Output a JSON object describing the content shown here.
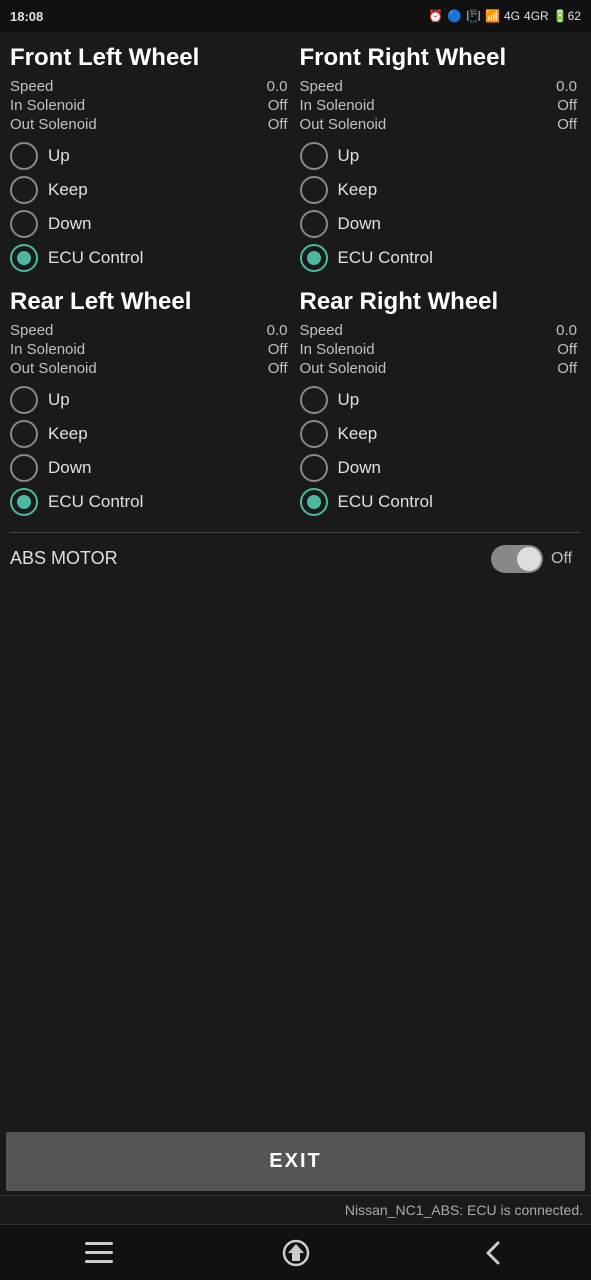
{
  "statusBar": {
    "time": "18:08",
    "rightIcons": "⏰ 🔵 📳 📶 4G 4GR 🔋62"
  },
  "wheels": [
    {
      "id": "front-left",
      "title": "Front Left Wheel",
      "speed": "0.0",
      "inSolenoid": "Off",
      "outSolenoid": "Off",
      "options": [
        "Up",
        "Keep",
        "Down",
        "ECU Control"
      ],
      "selected": 3
    },
    {
      "id": "front-right",
      "title": "Front Right Wheel",
      "speed": "0.0",
      "inSolenoid": "Off",
      "outSolenoid": "Off",
      "options": [
        "Up",
        "Keep",
        "Down",
        "ECU Control"
      ],
      "selected": 3
    },
    {
      "id": "rear-left",
      "title": "Rear Left Wheel",
      "speed": "0.0",
      "inSolenoid": "Off",
      "outSolenoid": "Off",
      "options": [
        "Up",
        "Keep",
        "Down",
        "ECU Control"
      ],
      "selected": 3
    },
    {
      "id": "rear-right",
      "title": "Rear Right Wheel",
      "speed": "0.0",
      "inSolenoid": "Off",
      "outSolenoid": "Off",
      "options": [
        "Up",
        "Keep",
        "Down",
        "ECU Control"
      ],
      "selected": 3
    }
  ],
  "absMotor": {
    "label": "ABS MOTOR",
    "value": "Off",
    "enabled": false
  },
  "exitButton": "EXIT",
  "ecuStatus": "Nissan_NC1_ABS: ECU is connected.",
  "bottomNav": {
    "menu": "☰",
    "home": "⌂",
    "back": "<"
  }
}
